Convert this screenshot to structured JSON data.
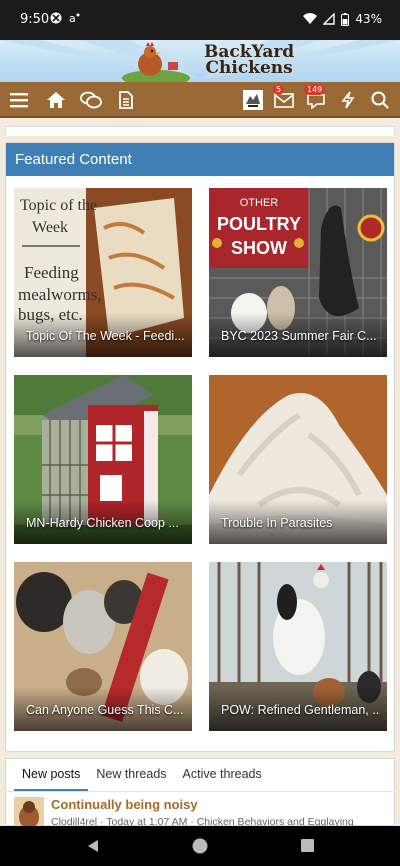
{
  "status_bar": {
    "time": "9:50",
    "battery": "43%"
  },
  "site": {
    "logo_line1": "BackYard",
    "logo_line2": "Chickens"
  },
  "nav": {
    "messages_badge": "5",
    "alerts_badge": "149"
  },
  "featured": {
    "title": "Featured Content",
    "tiles": [
      {
        "caption": "Topic Of The Week - Feedi...",
        "img_text": [
          "Topic of the",
          "Week",
          "Feeding",
          "mealworms,",
          "bugs, etc."
        ]
      },
      {
        "caption": "BYC 2023 Summer Fair C...",
        "img_text": [
          "OTHER",
          "POULTRY",
          "SHOW"
        ]
      },
      {
        "caption": "MN-Hardy Chicken Coop ..."
      },
      {
        "caption": "Trouble In Parasites"
      },
      {
        "caption": "Can Anyone Guess This C..."
      },
      {
        "caption": "POW: Refined Gentleman, ..."
      }
    ]
  },
  "posts": {
    "tabs": [
      "New posts",
      "New threads",
      "Active threads"
    ],
    "first": {
      "title": "Continually being noisy",
      "meta": "Clodill4rel · Today at 1:07 AM · Chicken Behaviors and Egglaying"
    }
  },
  "colors": {
    "nav_brown": "#9a6a36",
    "header_blue": "#3f7fb5",
    "link_brown": "#a5692a"
  }
}
